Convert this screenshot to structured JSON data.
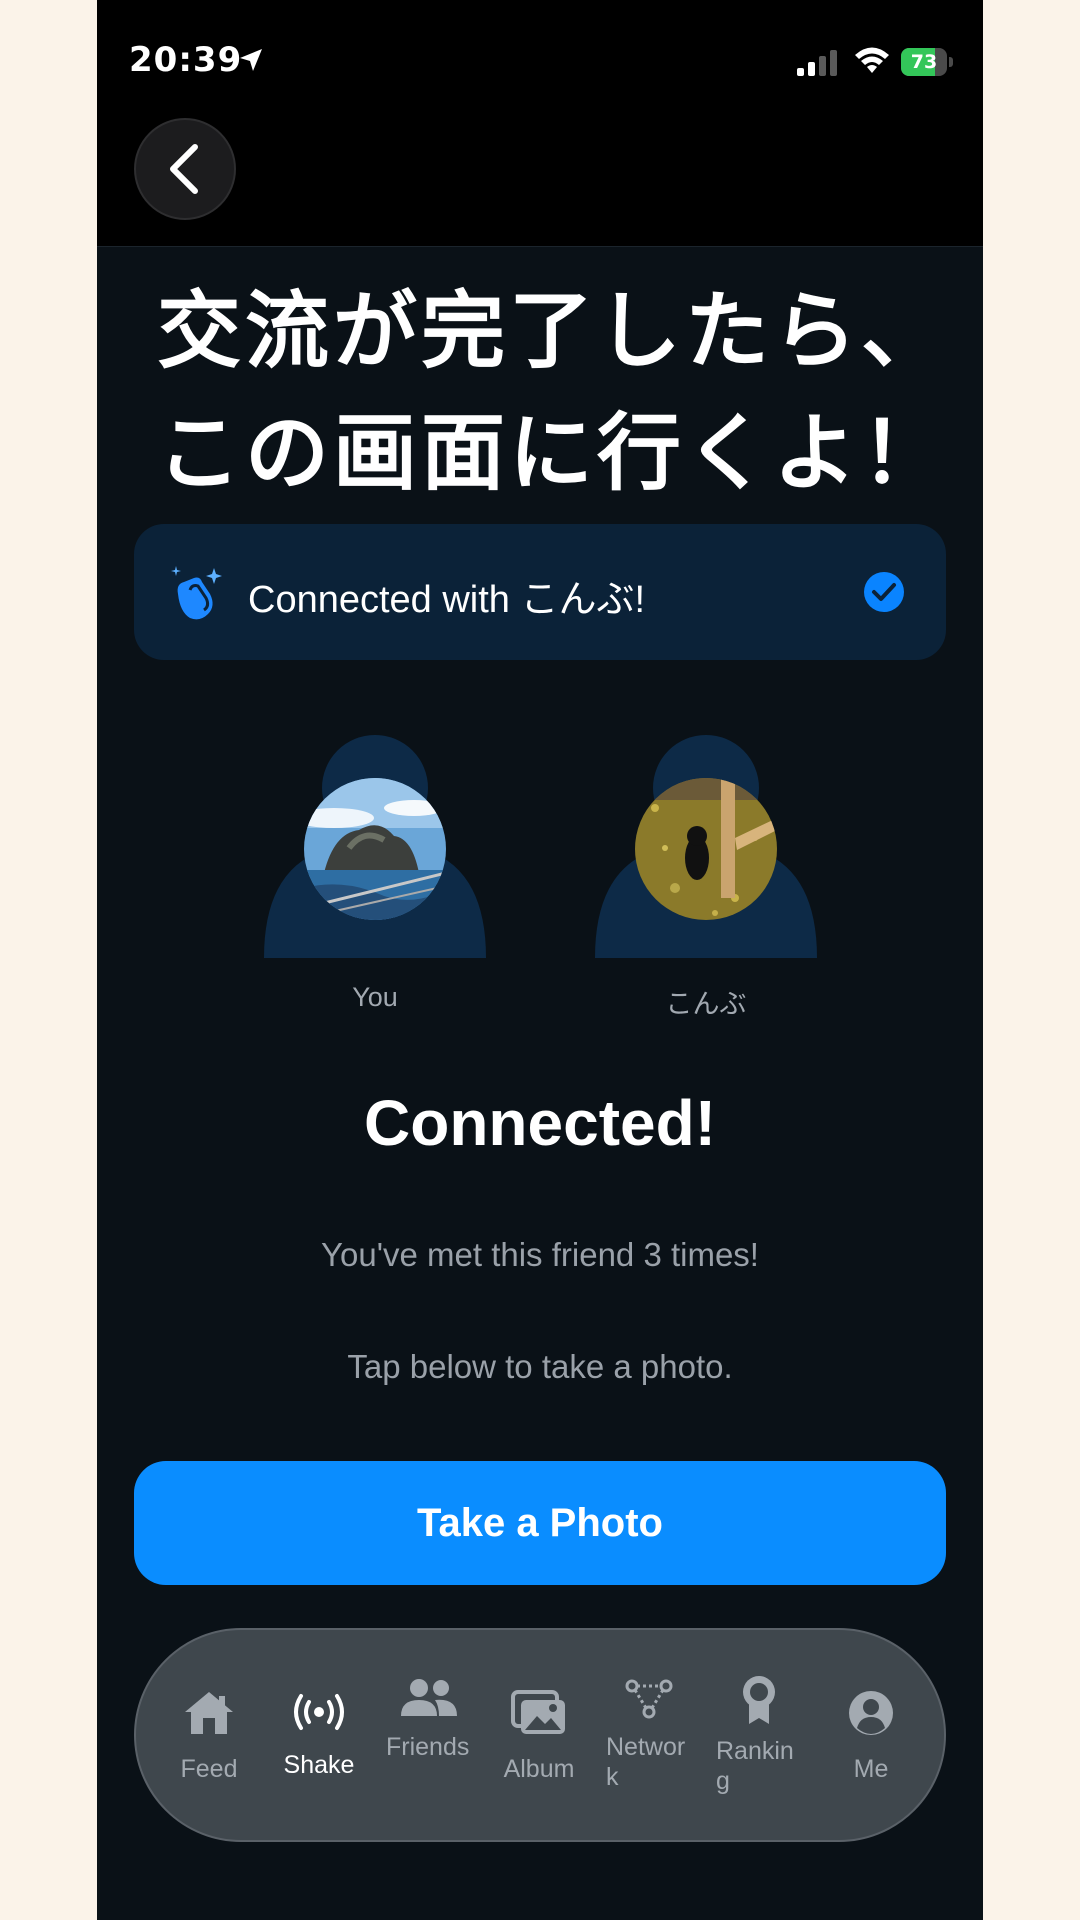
{
  "status_bar": {
    "time": "20:39",
    "battery": "73",
    "battery_level": 0.73,
    "battery_color": "#33c659"
  },
  "overlay": {
    "line1": "交流が完了したら、",
    "line2": "この画面に行くよ！"
  },
  "banner": {
    "icon": "clapping-hands-icon",
    "text": "Connected with こんぶ!",
    "check_icon": "checkmark-circle-icon"
  },
  "people": {
    "you_label": "You",
    "friend_label": "こんぶ"
  },
  "main": {
    "heading": "Connected!",
    "met_text": "You've met this friend 3 times!",
    "instruction": "Tap below to take a photo.",
    "button_label": "Take a Photo"
  },
  "tabs": [
    {
      "label": "Feed",
      "icon": "house-icon"
    },
    {
      "label": "Shake",
      "icon": "broadcast-icon"
    },
    {
      "label": "Friends",
      "icon": "people-icon"
    },
    {
      "label": "Album",
      "icon": "photos-icon"
    },
    {
      "label": "Network",
      "icon": "network-icon"
    },
    {
      "label": "Ranking",
      "icon": "award-icon"
    },
    {
      "label": "Me",
      "icon": "person-circle-icon"
    }
  ],
  "active_tab": "Shake",
  "colors": {
    "accent": "#0a8dff",
    "background": "#0a1117",
    "banner": "#0b2238",
    "page_margin": "#fbf3e9"
  }
}
